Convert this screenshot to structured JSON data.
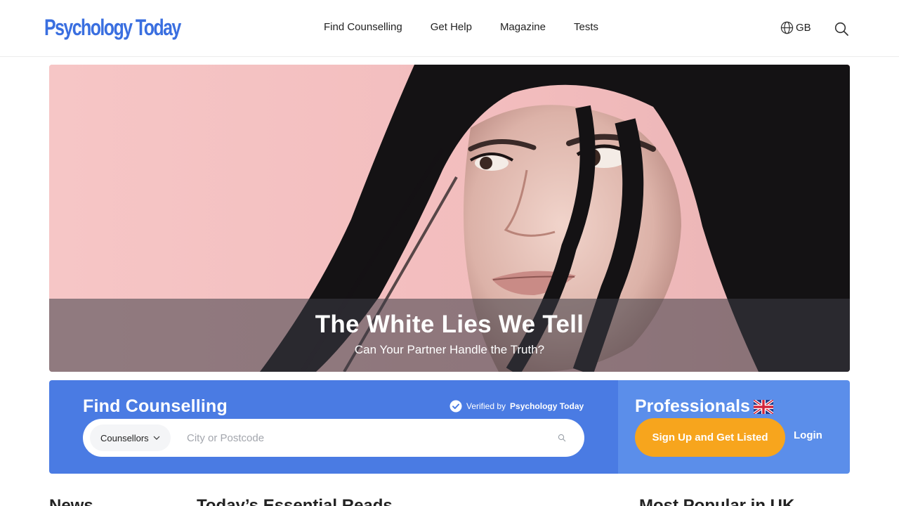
{
  "header": {
    "logo_text": "Psychology Today",
    "nav": [
      "Find Counselling",
      "Get Help",
      "Magazine",
      "Tests"
    ],
    "locale": "GB",
    "icons": {
      "globe": "globe-icon",
      "search": "search-icon"
    }
  },
  "hero": {
    "title": "The White Lies We Tell",
    "subtitle": "Can Your Partner Handle the Truth?"
  },
  "finder": {
    "title": "Find Counselling",
    "verified_prefix": "Verified by",
    "verified_brand": "Psychology Today",
    "type_select": "Counsellors",
    "city_placeholder": "City or Postcode"
  },
  "professionals": {
    "title": "Professionals",
    "signup_label": "Sign Up and Get Listed",
    "login_label": "Login"
  },
  "sections": [
    "News",
    "Today’s Essential Reads",
    "Most Popular in UK"
  ],
  "colors": {
    "brand_blue": "#4a7be3",
    "pros_blue": "#5b8eea",
    "accent_orange": "#f7a51d",
    "hero_pink": "#f4c3c4"
  }
}
